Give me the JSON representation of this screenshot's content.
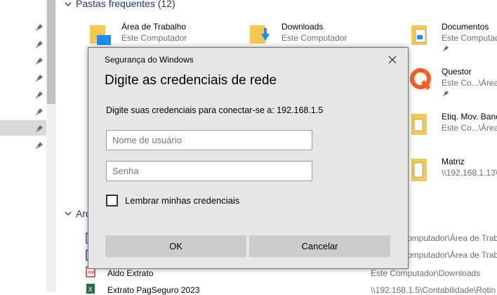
{
  "explorer": {
    "frequent_header": "Pastas frequentes (12)",
    "recent_header": "Arq",
    "favorites": [
      {
        "title": "Área de Trabalho",
        "subtitle": "Este Computador",
        "icon": "desktop-folder-icon"
      },
      {
        "title": "Downloads",
        "subtitle": "Este Computador",
        "icon": "downloads-folder-icon"
      },
      {
        "title": "Documentos",
        "subtitle": "Este Computad",
        "icon": "documents-folder-icon"
      },
      {
        "title": "Questor",
        "subtitle": "Este Co...\\Área d",
        "icon": "questor-app-icon"
      },
      {
        "title": "Etiq. Mov. Banc",
        "subtitle": "Este Co...\\Área d",
        "icon": "folder-icon"
      },
      {
        "title": "Matriz",
        "subtitle": "\\\\192.168.1.13\\",
        "icon": "folder-icon"
      }
    ],
    "recent_files": [
      {
        "name": "",
        "path": "omputador\\Área de Trabalh",
        "icon": "document-icon"
      },
      {
        "name": "",
        "path": "omputador\\Área de Trabalh",
        "icon": "document-icon"
      },
      {
        "name": "Aldo Extrato",
        "path": "Este Computador\\Downloads",
        "icon": "pdf-icon"
      },
      {
        "name": "Extrato PagSeguro 2023",
        "path": "\\\\192.168.1.5\\Contabilidade\\Rotin",
        "icon": "excel-icon"
      }
    ]
  },
  "dialog": {
    "caption": "Segurança do Windows",
    "heading": "Digite as credenciais de rede",
    "prompt": "Digite suas credenciais para conectar-se a: 192.168.1.5",
    "username_placeholder": "Nome de usuário",
    "username_value": "",
    "password_placeholder": "Senha",
    "password_value": "",
    "remember_label": "Lembrar minhas credenciais",
    "remember_checked": false,
    "ok_label": "OK",
    "cancel_label": "Cancelar"
  },
  "colors": {
    "header_blue": "#1e3287",
    "dialog_bg": "#e6e6e6",
    "button_bg": "#cccccc",
    "folder_yellow": "#f5c84c"
  }
}
